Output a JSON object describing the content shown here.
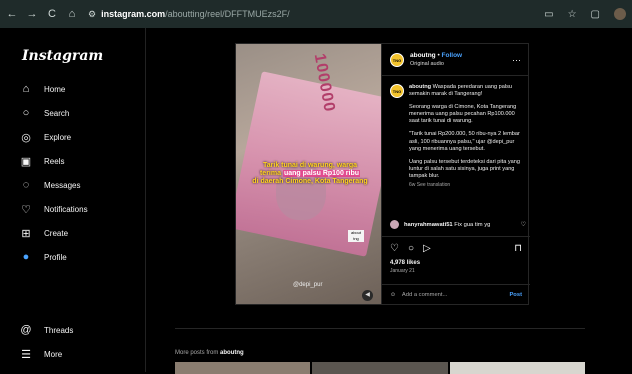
{
  "browser": {
    "back": "←",
    "forward": "→",
    "reload": "C",
    "home": "⌂",
    "url_host": "instagram.com",
    "url_path": "/aboutting/reel/DFFTMUEzs2F/"
  },
  "sidebar": {
    "logo": "Instagram",
    "items": [
      {
        "label": "Home",
        "icon": "⌂"
      },
      {
        "label": "Search",
        "icon": "○"
      },
      {
        "label": "Explore",
        "icon": "◎"
      },
      {
        "label": "Reels",
        "icon": "▣"
      },
      {
        "label": "Messages",
        "icon": "◌"
      },
      {
        "label": "Notifications",
        "icon": "♡"
      },
      {
        "label": "Create",
        "icon": "⊞"
      },
      {
        "label": "Profile",
        "icon": "●"
      }
    ],
    "threads": "Threads",
    "more": "More"
  },
  "post": {
    "overlay_line1": "Tarik tunai di warung, warga",
    "overlay_line2a": "terima ",
    "overlay_line2b": "uang palsu Rp100 ribu",
    "overlay_line3": "di daerah Cimone, Kota Tangerang",
    "note_number": "100000",
    "watermark": "@depi_pur",
    "stamp": "about tng",
    "author": "aboutng",
    "follow": "Follow",
    "audio": "Original audio",
    "caption_author": "aboutng",
    "caption_lead": " Waspada peredaran uang palsu semakin marak di Tangerang!",
    "caption_p2": "Seorang warga di Cimone, Kota Tangerang menerima uang palsu pecahan Rp100.000 saat tarik tunai di warung.",
    "caption_p3": "\"Tarik tunai Rp200.000, 50 ribu-nya 2 lembar asli, 100 ribuannya palsu,\" ujar @depi_pur yang menerima uang tersebut.",
    "caption_p4": "Uang palsu tersebut terdeteksi dari pita yang luntur di salah satu sisinya, juga print yang tampak blur.",
    "caption_age": "6w",
    "see_translation": "See translation",
    "comment_user": "hanyrahmawati51",
    "comment_text": " Fix gua tim yg",
    "likes": "4,978 likes",
    "date": "January 21",
    "add_comment_placeholder": "Add a comment...",
    "post_button": "Post"
  },
  "more_posts": {
    "prefix": "More posts from ",
    "author": "aboutng"
  }
}
